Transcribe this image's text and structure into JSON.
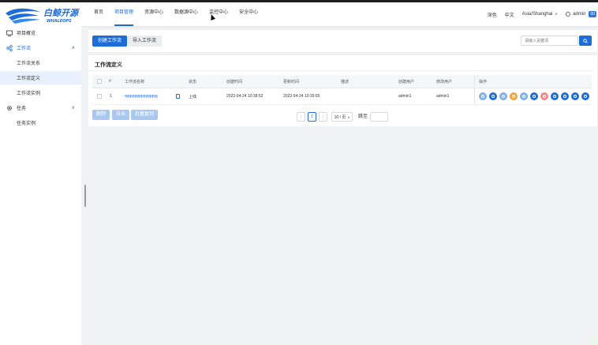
{
  "brand": {
    "name": "白鲸开源",
    "sub": "WHALEOPS"
  },
  "nav": {
    "items": [
      "首页",
      "项目管理",
      "资源中心",
      "数据源中心",
      "监控中心",
      "安全中心"
    ],
    "active": 1
  },
  "topright": {
    "theme": "深色",
    "lang": "中文",
    "timezone": "Asia/Shanghai",
    "user": "admin",
    "badge": "00"
  },
  "sidebar": {
    "overview": "项目概览",
    "workflow": "工作流",
    "workflow_relation": "工作流关系",
    "workflow_definition": "工作流定义",
    "workflow_instance": "工作流实例",
    "task": "任务",
    "task_instance": "任务实例"
  },
  "toolbar": {
    "create": "创建工作流",
    "import": "导入工作流",
    "search_placeholder": "请输入关键词"
  },
  "section": {
    "title": "工作流定义"
  },
  "table": {
    "headers": {
      "index": "#",
      "name": "工作流名称",
      "status": "状态",
      "created": "创建时间",
      "updated": "更新时间",
      "desc": "描述",
      "creator": "创建用户",
      "modifier": "修改用户",
      "ops": "操作"
    },
    "rows": [
      {
        "index": "1",
        "name": "qqqqqqqqqqqqqqq",
        "status": "上线",
        "created": "2022-04-24 10:38:52",
        "updated": "2022-04-24 10:39:55",
        "desc": "",
        "creator": "admin1",
        "modifier": "admin1"
      }
    ]
  },
  "ops_colors": [
    "#7fb0e8",
    "#1e6cd8",
    "#7fb0e8",
    "#f0a43a",
    "#7fb0e8",
    "#1e6cd8",
    "#f08a8a",
    "#1e6cd8",
    "#1e6cd8",
    "#1e6cd8",
    "#1e6cd8"
  ],
  "actions": {
    "delete": "删除",
    "export": "导出",
    "batch_copy": "批量复制"
  },
  "pagination": {
    "prev": "‹",
    "page": "1",
    "next": "›",
    "size": "10 / 页",
    "jump": "跳至"
  }
}
